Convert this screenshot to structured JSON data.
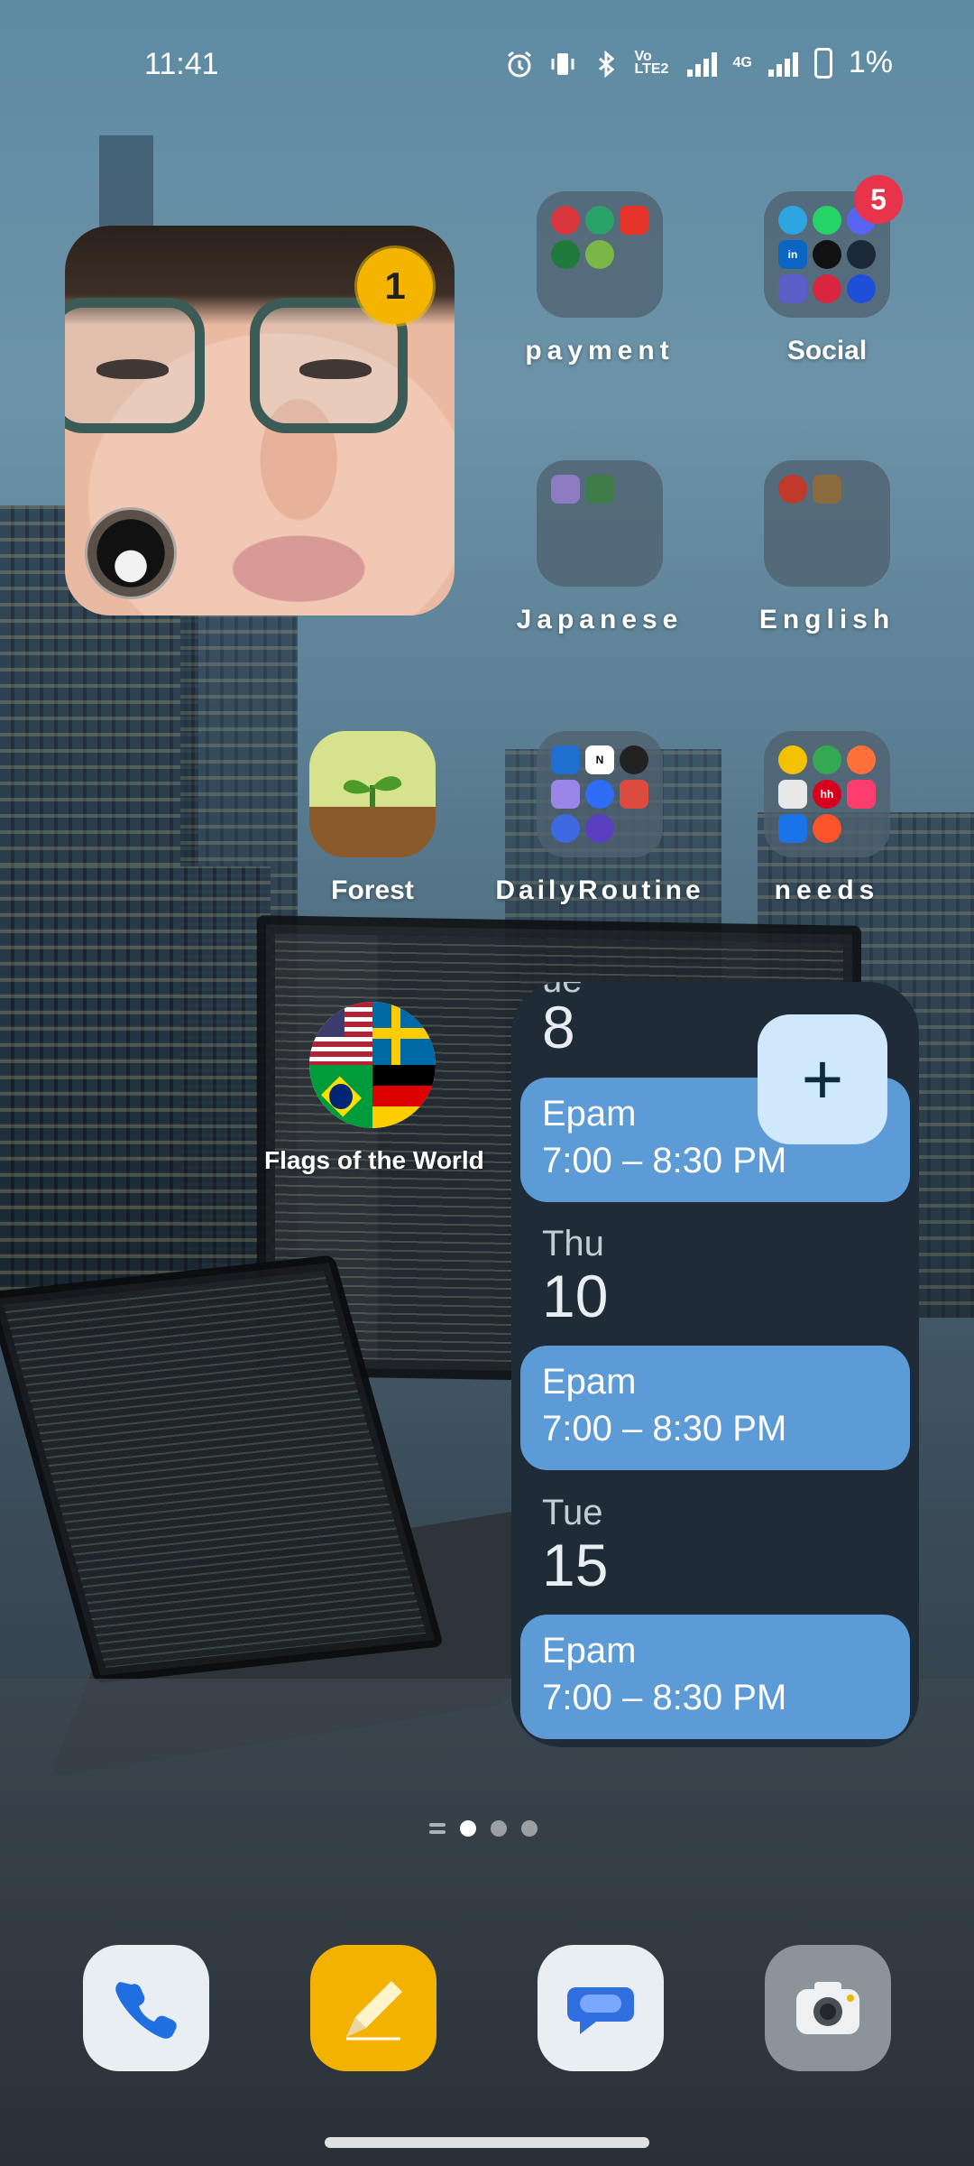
{
  "status_bar": {
    "time": "11:41",
    "volte_label": "Vo LTE2",
    "network_label": "4G",
    "battery_percent": "1%"
  },
  "photo_widget": {
    "badge_count": "1"
  },
  "apps": {
    "payment": {
      "label": "payment"
    },
    "social": {
      "label": "Social",
      "badge": "5"
    },
    "japanese": {
      "label": "Japanese"
    },
    "english": {
      "label": "English"
    },
    "forest": {
      "label": "Forest"
    },
    "daily_routine": {
      "label": "DailyRoutine"
    },
    "needs": {
      "label": "needs"
    },
    "flags": {
      "label": "Flags of the World"
    }
  },
  "calendar": {
    "days": [
      {
        "dow": "ue",
        "date": "8",
        "event": {
          "title": "Epam",
          "time": "7:00 – 8:30 PM"
        }
      },
      {
        "dow": "Thu",
        "date": "10",
        "event": {
          "title": "Epam",
          "time": "7:00 – 8:30 PM"
        }
      },
      {
        "dow": "Tue",
        "date": "15",
        "event": {
          "title": "Epam",
          "time": "7:00 – 8:30 PM"
        }
      }
    ],
    "add_label": "+"
  },
  "pager": {
    "active_page": 1,
    "page_count": 3
  },
  "dock": [
    {
      "name": "phone"
    },
    {
      "name": "notes"
    },
    {
      "name": "messages"
    },
    {
      "name": "camera"
    }
  ],
  "colors": {
    "calendar_bg": "#1f2b36",
    "event_bg": "#5c9bd6",
    "add_button_bg": "#cfe8fb",
    "badge_red": "#e8344a",
    "badge_yellow": "#f5b400"
  }
}
